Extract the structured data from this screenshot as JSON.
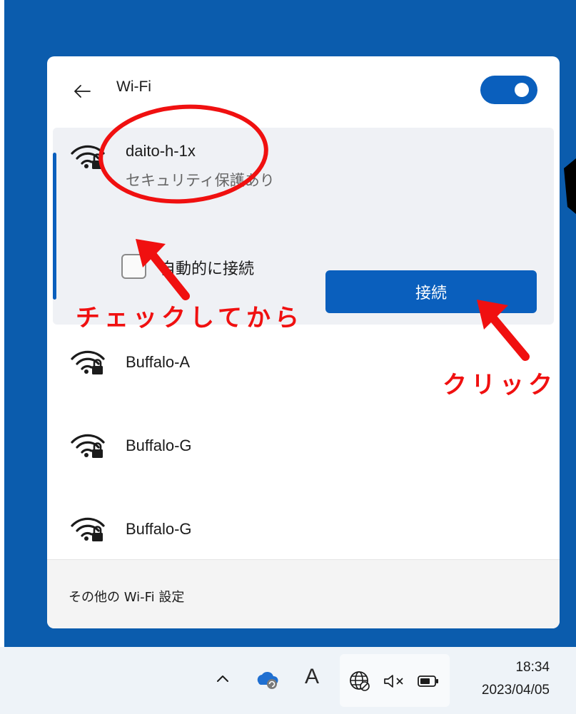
{
  "panel": {
    "title": "Wi-Fi",
    "toggle_on": true,
    "accent_color": "#0a5fbd"
  },
  "selected_network": {
    "ssid": "daito-h-1x",
    "status": "セキュリティ保護あり",
    "auto_connect_label": "自動的に接続",
    "auto_connect_checked": false,
    "connect_label": "接続"
  },
  "networks": [
    {
      "ssid": "Buffalo-A"
    },
    {
      "ssid": "Buffalo-G"
    },
    {
      "ssid": "Buffalo-G"
    }
  ],
  "footer": {
    "settings_link": "その他の Wi-Fi 設定"
  },
  "taskbar": {
    "time": "18:34",
    "date": "2023/04/05",
    "ime_label": "A",
    "icons": [
      "chevron-up-icon",
      "onedrive-icon",
      "globe-icon",
      "speaker-muted-icon",
      "battery-icon"
    ]
  },
  "annotations": {
    "check_first": "チェックしてから",
    "click": "クリック",
    "color": "#f01010"
  }
}
